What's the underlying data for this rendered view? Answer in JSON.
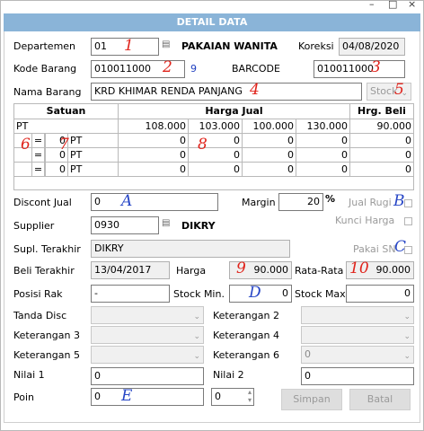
{
  "window": {
    "minimize": "–",
    "maximize": "□",
    "close": "×"
  },
  "header": {
    "title": "DETAIL DATA"
  },
  "form": {
    "departemen_label": "Departemen",
    "departemen_value": "01",
    "departemen_name": "PAKAIAN WANITA",
    "koreksi_label": "Koreksi",
    "koreksi_value": "04/08/2020",
    "kode_barang_label": "Kode Barang",
    "kode_barang_value": "010011000",
    "kode_barang_digit": "9",
    "barcode_label": "BARCODE",
    "barcode_value": "010011000",
    "nama_barang_label": "Nama Barang",
    "nama_barang_value": "KRD KHIMAR RENDA PANJANG",
    "stock_select": "Stock",
    "discont_jual_label": "Discont Jual",
    "discont_jual_value": "0",
    "margin_label": "Margin",
    "margin_value": "20",
    "margin_unit": "%",
    "jual_rugi_label": "Jual Rugi",
    "kunci_harga_label": "Kunci Harga",
    "supplier_label": "Supplier",
    "supplier_code": "0930",
    "supplier_name": "DIKRY",
    "supl_terakhir_label": "Supl. Terakhir",
    "supl_terakhir_value": "DIKRY",
    "pakai_sn_label": "Pakai SN",
    "beli_terakhir_label": "Beli Terakhir",
    "beli_terakhir_value": "13/04/2017",
    "harga_label": "Harga",
    "harga_value": "90.000",
    "rata_rata_label": "Rata-Rata",
    "rata_rata_value": "90.000",
    "posisi_rak_label": "Posisi Rak",
    "posisi_rak_value": "-",
    "stock_min_label": "Stock Min.",
    "stock_min_value": "0",
    "stock_max_label": "Stock Max.",
    "stock_max_value": "0",
    "tanda_disc_label": "Tanda Disc",
    "keterangan2_label": "Keterangan 2",
    "keterangan3_label": "Keterangan 3",
    "keterangan4_label": "Keterangan 4",
    "keterangan5_label": "Keterangan 5",
    "keterangan6_label": "Keterangan 6",
    "keterangan6_value": "0",
    "nilai1_label": "Nilai 1",
    "nilai1_value": "0",
    "nilai2_label": "Nilai 2",
    "nilai2_value": "0",
    "poin_label": "Poin",
    "poin_value": "0",
    "poin_spin_value": "0"
  },
  "price_table": {
    "satuan_header": "Satuan",
    "harga_jual_header": "Harga Jual",
    "hrg_beli_header": "Hrg. Beli",
    "rows": [
      {
        "unit": "PT",
        "eq": "",
        "qty": "",
        "unit2": "",
        "prices": [
          "108.000",
          "103.000",
          "100.000",
          "130.000",
          "90.000"
        ]
      },
      {
        "unit": "",
        "eq": "=",
        "qty": "0",
        "unit2": "PT",
        "prices": [
          "0",
          "0",
          "0",
          "0",
          "0"
        ]
      },
      {
        "unit": "",
        "eq": "=",
        "qty": "0",
        "unit2": "PT",
        "prices": [
          "0",
          "0",
          "0",
          "0",
          "0"
        ]
      },
      {
        "unit": "",
        "eq": "=",
        "qty": "0",
        "unit2": "PT",
        "prices": [
          "0",
          "0",
          "0",
          "0",
          "0"
        ]
      }
    ]
  },
  "buttons": {
    "simpan": "Simpan",
    "batal": "Batal"
  },
  "annotations": {
    "n1": "1",
    "n2": "2",
    "n3": "3",
    "n4": "4",
    "n5": "5",
    "n6": "6",
    "n7": "7",
    "n8": "8",
    "n9": "9",
    "n10": "10",
    "A": "A",
    "B": "B",
    "C": "C",
    "D": "D",
    "E": "E"
  },
  "colors": {
    "header_bg": "#8ab4d8",
    "annotation_red": "#e0231b",
    "annotation_blue": "#2746c6"
  }
}
